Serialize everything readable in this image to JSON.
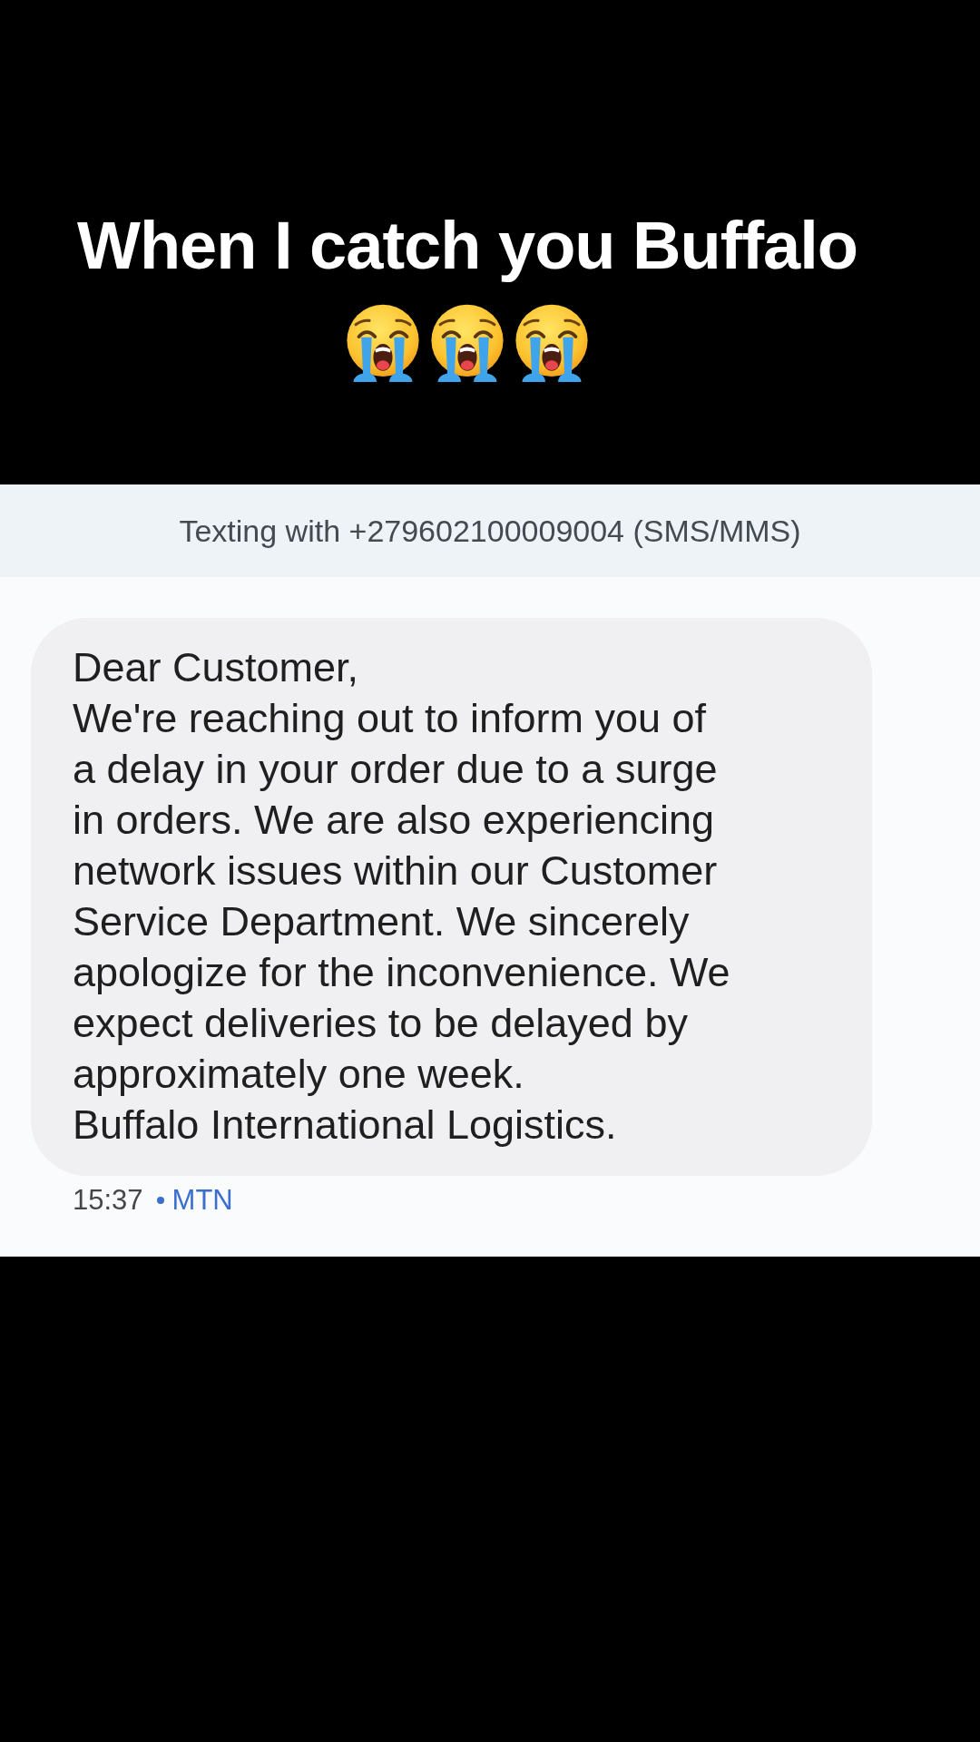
{
  "caption": {
    "text": "When I catch you Buffalo",
    "emojis": [
      {
        "kind": "loudly-crying"
      },
      {
        "kind": "loudly-crying"
      },
      {
        "kind": "loudly-crying"
      }
    ]
  },
  "conversation_header": {
    "text": "Texting with +279602100009004 (SMS/MMS)"
  },
  "messages": [
    {
      "kind": "incoming",
      "text": "Dear Customer,\nWe're reaching out to inform you of a delay in your order due to a surge in orders. We are also experiencing network issues within our Customer Service Department. We sincerely apologize for the inconvenience. We expect deliveries to be delayed by approximately one week.\nBuffalo International Logistics.",
      "time": "15:37",
      "carrier": "MTN"
    }
  ]
}
